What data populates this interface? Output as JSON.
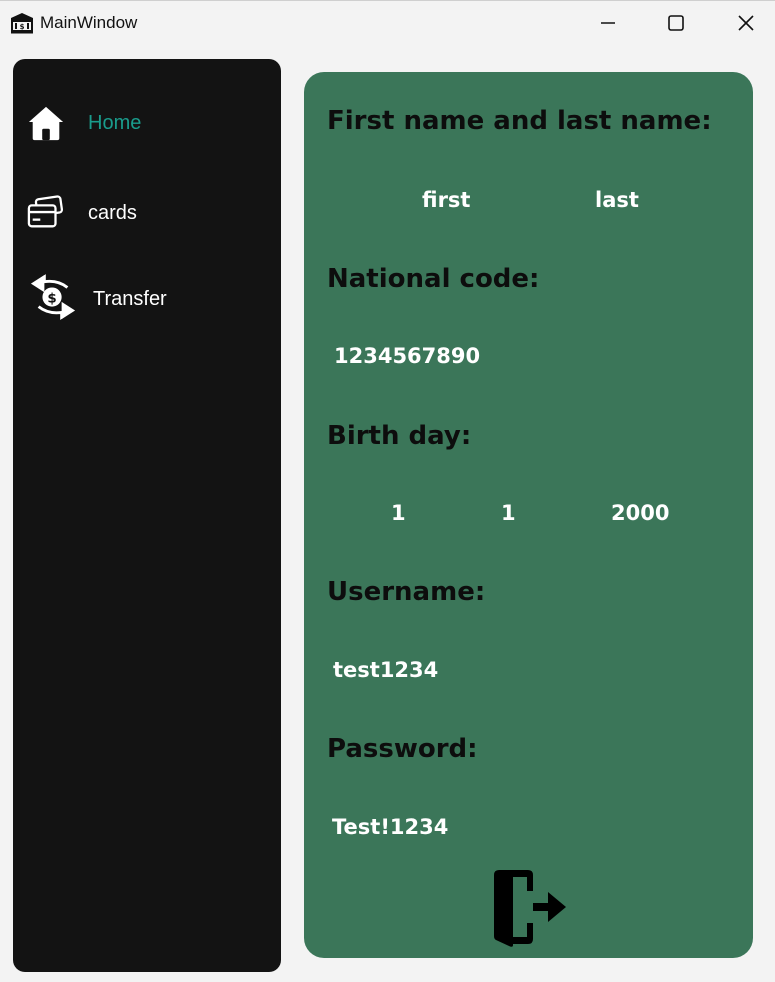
{
  "window": {
    "title": "MainWindow",
    "app_icon": "bank-icon",
    "controls": [
      "minimize-icon",
      "maximize-icon",
      "close-icon"
    ]
  },
  "sidebar": {
    "items": [
      {
        "label": "Home",
        "icon": "home-icon",
        "active": true
      },
      {
        "label": "cards",
        "icon": "credit-card-icon",
        "active": false
      },
      {
        "label": "Transfer",
        "icon": "money-transfer-icon",
        "active": false
      }
    ]
  },
  "profile": {
    "name_label": "First name and last name:",
    "first_name": "first",
    "last_name": "last",
    "national_code_label": "National code:",
    "national_code": "1234567890",
    "birthday_label": "Birth day:",
    "birth_day": "1",
    "birth_month": "1",
    "birth_year": "2000",
    "username_label": "Username:",
    "username": "test1234",
    "password_label": "Password:",
    "password": "Test!1234",
    "logout_icon": "exit-door-icon"
  },
  "colors": {
    "sidebar_bg": "#131313",
    "panel_bg": "#3b7659",
    "active_nav": "#1a9c8c",
    "window_bg": "#f3f3f3"
  }
}
